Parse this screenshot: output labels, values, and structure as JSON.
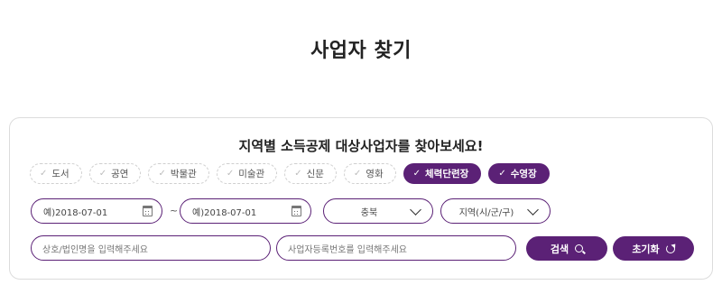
{
  "page": {
    "title": "사업자 찾기"
  },
  "panel": {
    "heading": "지역별 소득공제 대상사업자를 찾아보세요!"
  },
  "categories": [
    {
      "label": "도서",
      "selected": false
    },
    {
      "label": "공연",
      "selected": false
    },
    {
      "label": "박물관",
      "selected": false
    },
    {
      "label": "미술관",
      "selected": false
    },
    {
      "label": "신문",
      "selected": false
    },
    {
      "label": "영화",
      "selected": false
    },
    {
      "label": "체력단련장",
      "selected": true
    },
    {
      "label": "수영장",
      "selected": true
    }
  ],
  "date_range": {
    "start_placeholder": "예)2018-07-01",
    "end_placeholder": "예)2018-07-01",
    "separator": "~"
  },
  "region": {
    "province_value": "충북",
    "district_placeholder": "지역(시/군/구)"
  },
  "search": {
    "name_placeholder": "상호/법인명을 입력해주세요",
    "regno_placeholder": "사업자등록번호를 입력해주세요",
    "search_label": "검색",
    "reset_label": "초기화"
  },
  "colors": {
    "accent": "#5b2176",
    "border": "#dcdcdc",
    "chip_border": "#cfcfcf"
  }
}
